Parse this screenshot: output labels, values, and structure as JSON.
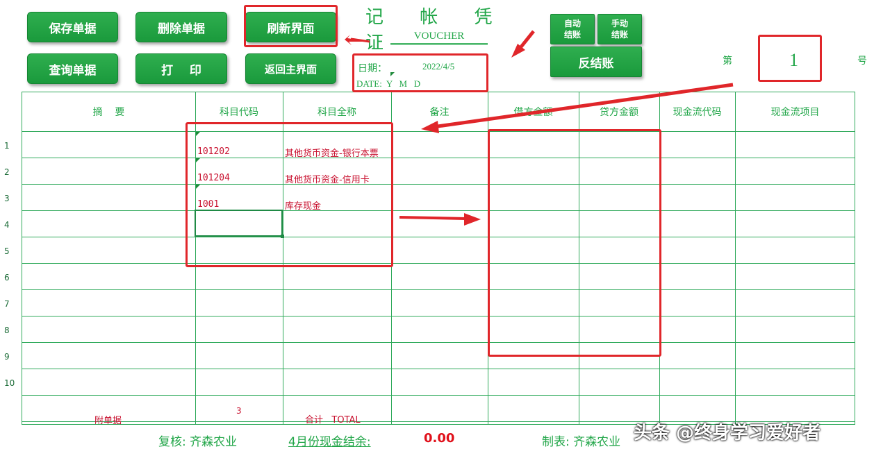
{
  "toolbar": {
    "save": "保存单据",
    "delete": "删除单据",
    "refresh": "刷新界面",
    "query": "查询单据",
    "print": "打    印",
    "back": "返回主界面",
    "auto_close": "自动\n结账",
    "manual_close": "手动\n结账",
    "reverse_close": "反结账"
  },
  "voucher": {
    "title": "记 帐 凭 证",
    "subtitle": "VOUCHER",
    "date_label": "日期：",
    "date_value": "2022/4/5",
    "date_en": "DATE:  Y   M   D",
    "number_prefix": "第",
    "number_value": "1",
    "number_suffix": "号"
  },
  "table": {
    "headers": [
      "摘    要",
      "科目代码",
      "科目全称",
      "备注",
      "借方金额",
      "贷方金额",
      "现金流代码",
      "现金流项目"
    ],
    "row_numbers": [
      "1",
      "2",
      "3",
      "4",
      "5",
      "6",
      "7",
      "8",
      "9",
      "10"
    ],
    "rows": [
      {
        "code": "101202",
        "name": "其他货币资金-银行本票"
      },
      {
        "code": "101204",
        "name": "其他货币资金-信用卡"
      },
      {
        "code": "1001",
        "name": "库存现金"
      }
    ],
    "footer": {
      "attach_label": "附单据",
      "attach_count": "3",
      "total_label": "合计   TOTAL"
    }
  },
  "bottom": {
    "review": "复核: 齐森农业",
    "cash_balance_label": "4月份现金结余:",
    "cash_balance_value": "0.00",
    "maker": "制表: 齐森农业",
    "watermark": "头条 @终身学习爱好者"
  },
  "colors": {
    "button_green": "#1a9a3c",
    "grid_green": "#2ea95a",
    "text_red": "#c8102e",
    "annotation_red": "#e0262a"
  }
}
